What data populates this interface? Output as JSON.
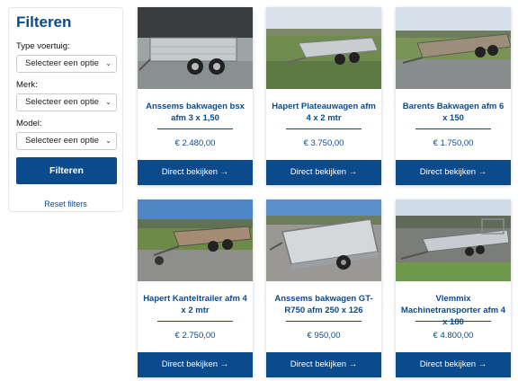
{
  "filter": {
    "title": "Filteren",
    "type_label": "Type voertuig:",
    "brand_label": "Merk:",
    "model_label": "Model:",
    "select_placeholder": "Selecteer een optie",
    "submit_label": "Filteren",
    "reset_label": "Reset filters"
  },
  "products": [
    {
      "title": "Anssems bakwagen bsx afm 3 x 1,50",
      "price": "€ 2.480,00",
      "cta": "Direct bekijken →"
    },
    {
      "title": "Hapert Plateauwagen afm 4 x 2 mtr",
      "price": "€ 3.750,00",
      "cta": "Direct bekijken →"
    },
    {
      "title": "Barents Bakwagen afm 6 x 150",
      "price": "€ 1.750,00",
      "cta": "Direct bekijken →"
    },
    {
      "title": "Hapert Kanteltrailer afm 4 x 2 mtr",
      "price": "€ 2.750,00",
      "cta": "Direct bekijken →"
    },
    {
      "title": "Anssems bakwagen GT-R750 afm 250 x 126",
      "price": "€ 950,00",
      "cta": "Direct bekijken →"
    },
    {
      "title": "Vlemmix Machinetransporter afm 4 x 180",
      "price": "€ 4.800,00",
      "cta": "Direct bekijken →"
    }
  ]
}
